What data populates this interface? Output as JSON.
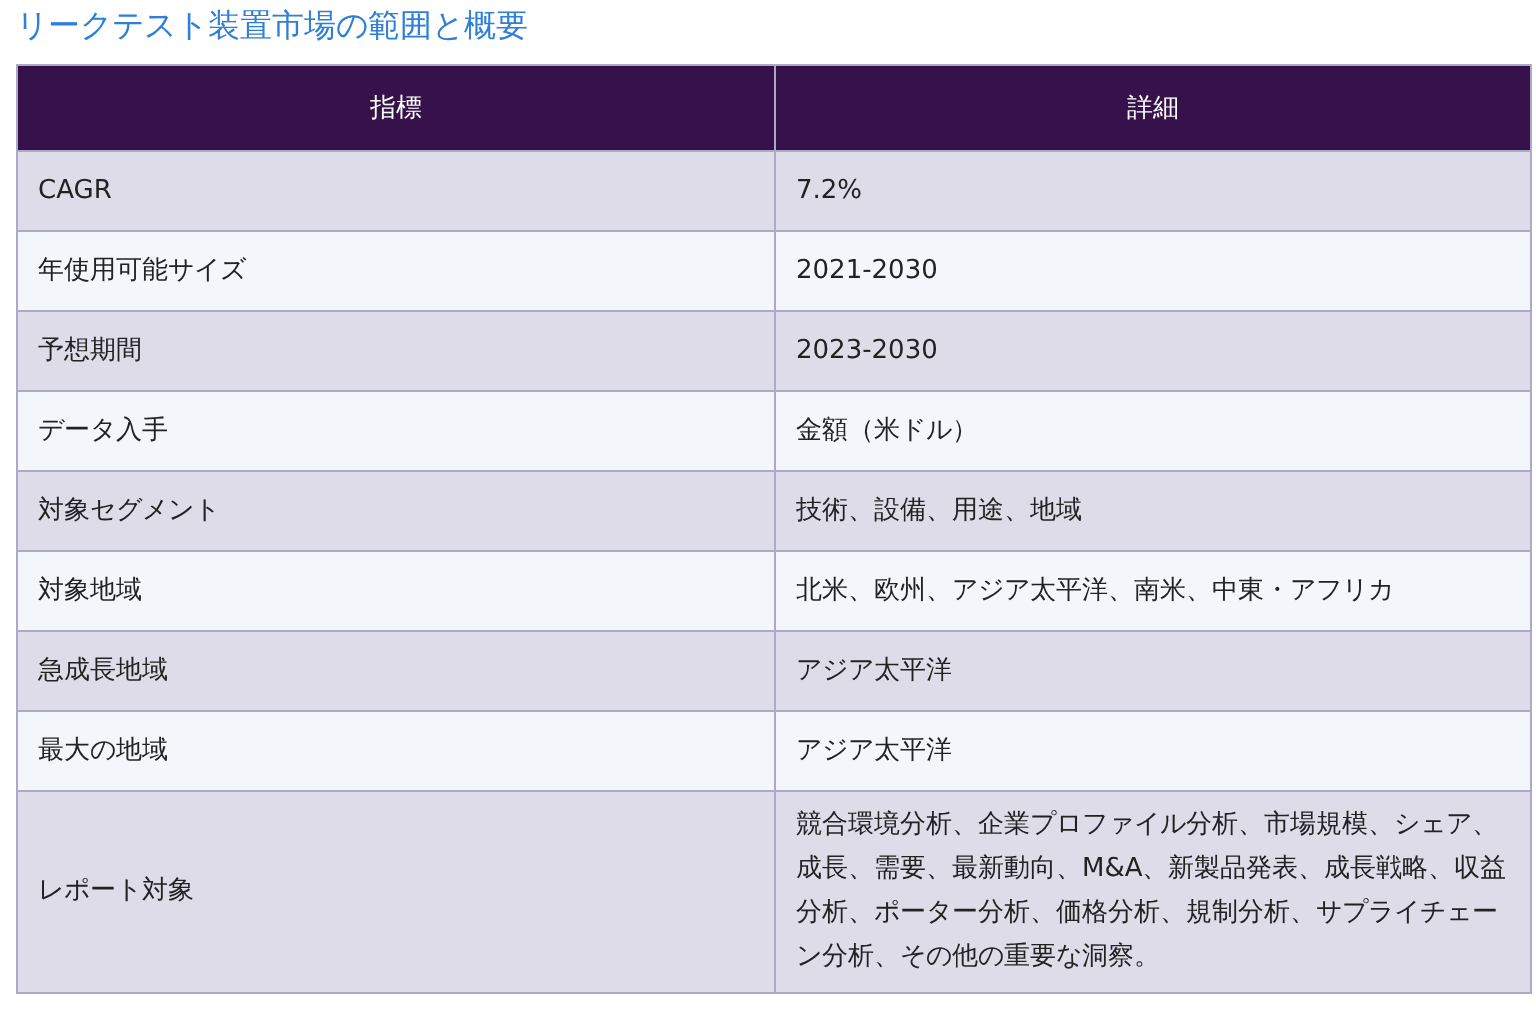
{
  "title": "リークテスト装置市場の範囲と概要",
  "table": {
    "columns": [
      "指標",
      "詳細"
    ],
    "rows": [
      [
        "CAGR",
        "7.2%"
      ],
      [
        "年使用可能サイズ",
        "2021-2030"
      ],
      [
        "予想期間",
        "2023-2030"
      ],
      [
        "データ入手",
        "金額（米ドル）"
      ],
      [
        "対象セグメント",
        "技術、設備、用途、地域"
      ],
      [
        "対象地域",
        "北米、欧州、アジア太平洋、南米、中東・アフリカ"
      ],
      [
        "急成長地域",
        "アジア太平洋"
      ],
      [
        "最大の地域",
        "アジア太平洋"
      ],
      [
        "レポート対象",
        "競合環境分析、企業プロファイル分析、市場規模、シェア、成長、需要、最新動向、M&A、新製品発表、成長戦略、収益分析、ポーター分析、価格分析、規制分析、サプライチェーン分析、その他の重要な洞察。"
      ]
    ]
  }
}
